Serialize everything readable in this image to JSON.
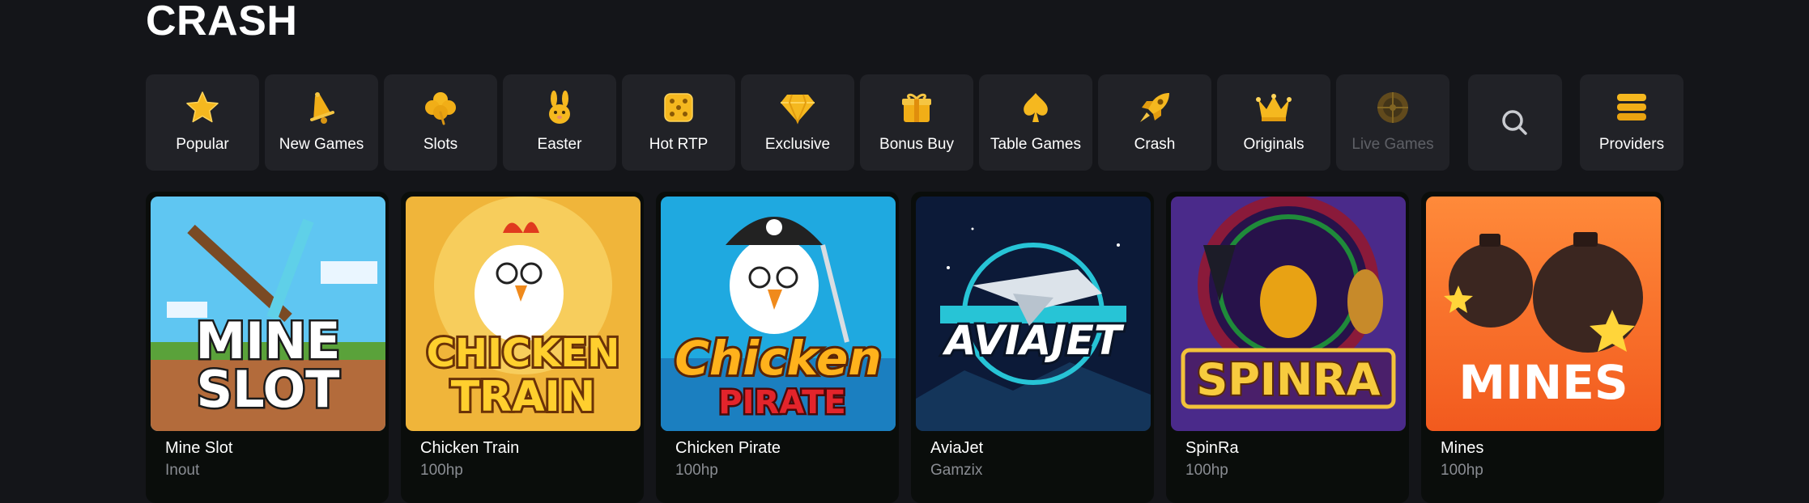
{
  "page": {
    "title": "CRASH"
  },
  "categories": [
    {
      "label": "Popular",
      "icon": "star-icon"
    },
    {
      "label": "New Games",
      "icon": "bell-icon"
    },
    {
      "label": "Slots",
      "icon": "clover-icon"
    },
    {
      "label": "Easter",
      "icon": "bunny-icon"
    },
    {
      "label": "Hot RTP",
      "icon": "dice-icon"
    },
    {
      "label": "Exclusive",
      "icon": "diamond-icon"
    },
    {
      "label": "Bonus Buy",
      "icon": "gift-icon"
    },
    {
      "label": "Table Games",
      "icon": "spade-icon"
    },
    {
      "label": "Crash",
      "icon": "rocket-icon"
    },
    {
      "label": "Originals",
      "icon": "crown-icon"
    },
    {
      "label": "Live Games",
      "icon": "roulette-icon"
    }
  ],
  "search": {
    "icon": "search-icon"
  },
  "providers": {
    "label": "Providers",
    "icon": "stack-icon"
  },
  "games": [
    {
      "name": "Mine Slot",
      "provider": "Inout",
      "art_text": [
        "MINE",
        "SLOT"
      ]
    },
    {
      "name": "Chicken Train",
      "provider": "100hp",
      "art_text": [
        "CHICKEN",
        "TRAIN"
      ]
    },
    {
      "name": "Chicken Pirate",
      "provider": "100hp",
      "art_text": [
        "Chicken",
        "PIRATE"
      ]
    },
    {
      "name": "AviaJet",
      "provider": "Gamzix",
      "art_text": [
        "AVIAJET"
      ]
    },
    {
      "name": "SpinRa",
      "provider": "100hp",
      "art_text": [
        "SPINRA"
      ]
    },
    {
      "name": "Mines",
      "provider": "100hp",
      "art_text": [
        "MINES"
      ]
    }
  ],
  "colors": {
    "background": "#141519",
    "tile": "#212227",
    "card": "#0a0d0b",
    "icon_gold": "#f5b81f",
    "muted_text": "#8a8d93"
  }
}
